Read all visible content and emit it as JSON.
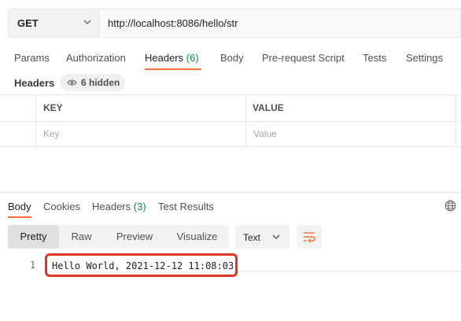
{
  "request": {
    "method": "GET",
    "url": "http://localhost:8086/hello/str"
  },
  "request_tabs": [
    {
      "label": "Params"
    },
    {
      "label": "Authorization"
    },
    {
      "label": "Headers",
      "count": "(6)"
    },
    {
      "label": "Body"
    },
    {
      "label": "Pre-request Script"
    },
    {
      "label": "Tests"
    },
    {
      "label": "Settings"
    }
  ],
  "headers_section": {
    "title": "Headers",
    "hidden_label": "6 hidden",
    "columns": [
      "KEY",
      "VALUE"
    ],
    "key_placeholder": "Key",
    "value_placeholder": "Value"
  },
  "response_tabs": [
    {
      "label": "Body"
    },
    {
      "label": "Cookies"
    },
    {
      "label": "Headers",
      "count": "(3)"
    },
    {
      "label": "Test Results"
    }
  ],
  "view_modes": [
    "Pretty",
    "Raw",
    "Preview",
    "Visualize"
  ],
  "format": "Text",
  "response_body": {
    "line_number": "1",
    "content": "Hello World, 2021-12-12 11:08:03"
  },
  "colors": {
    "accent": "#ff6c37",
    "count": "#0c8f45",
    "highlight": "#e0351f"
  }
}
